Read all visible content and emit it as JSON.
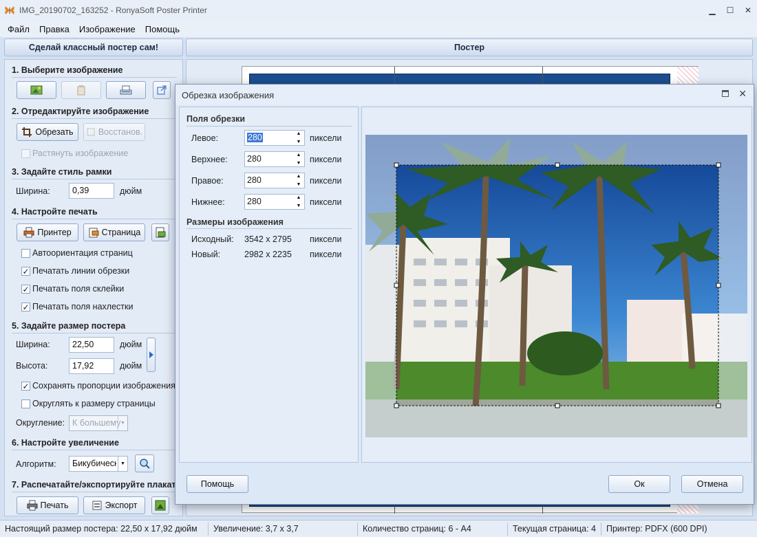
{
  "window": {
    "title": "IMG_20190702_163252 - RonyaSoft Poster Printer"
  },
  "menu": [
    "Файл",
    "Правка",
    "Изображение",
    "Помощь"
  ],
  "left_header": "Сделай классный постер сам!",
  "right_header": "Постер",
  "sections": {
    "s1": "1. Выберите изображение",
    "s2": "2. Отредактируйте изображение",
    "s3": "3. Задайте стиль рамки",
    "s4": "4. Настройте печать",
    "s5": "5. Задайте размер постера",
    "s6": "6. Настройте увеличение",
    "s7": "7. Распечатайте/экспортируйте плакат"
  },
  "edit": {
    "crop": "Обрезать",
    "restore": "Восстанов.",
    "stretch": "Растянуть изображение"
  },
  "frame": {
    "width_label": "Ширина:",
    "width_value": "0,39",
    "unit": "дюйм"
  },
  "print": {
    "printer": "Принтер",
    "page": "Страница",
    "auto_orient": "Автоориентация страниц",
    "cut_lines": "Печатать линии обрезки",
    "glue_fields": "Печатать поля склейки",
    "overlap_fields": "Печатать поля нахлестки"
  },
  "size": {
    "width_label": "Ширина:",
    "width_value": "22,50",
    "height_label": "Высота:",
    "height_value": "17,92",
    "unit": "дюйм",
    "keep_ratio": "Сохранять пропорции изображения",
    "round_to_page": "Округлять к размеру страницы",
    "rounding_label": "Округление:",
    "rounding_value": "К большему"
  },
  "zoom": {
    "algo_label": "Алгоритм:",
    "algo_value": "Бикубическ"
  },
  "export": {
    "print": "Печать",
    "export": "Экспорт"
  },
  "status": {
    "real_size": "Настоящий размер постера: 22,50 x 17,92 дюйм",
    "zoom": "Увеличение: 3,7 x 3,7",
    "pages": "Количество страниц: 6 - A4",
    "current_page": "Текущая страница: 4",
    "printer": "Принтер: PDFX (600 DPI)"
  },
  "dialog": {
    "title": "Обрезка изображения",
    "crop_fields_title": "Поля обрезки",
    "fields": [
      {
        "label": "Левое:",
        "value": "280",
        "unit": "пиксели"
      },
      {
        "label": "Верхнее:",
        "value": "280",
        "unit": "пиксели"
      },
      {
        "label": "Правое:",
        "value": "280",
        "unit": "пиксели"
      },
      {
        "label": "Нижнее:",
        "value": "280",
        "unit": "пиксели"
      }
    ],
    "sizes_title": "Размеры изображения",
    "original_label": "Исходный:",
    "original_value": "3542 x 2795",
    "new_label": "Новый:",
    "new_value": "2982 x 2235",
    "size_unit": "пиксели",
    "help": "Помощь",
    "ok": "Ок",
    "cancel": "Отмена"
  },
  "colors": {
    "accent": "#3b78d8",
    "panel": "#e3ebf7",
    "sky": "#1c57a8"
  }
}
